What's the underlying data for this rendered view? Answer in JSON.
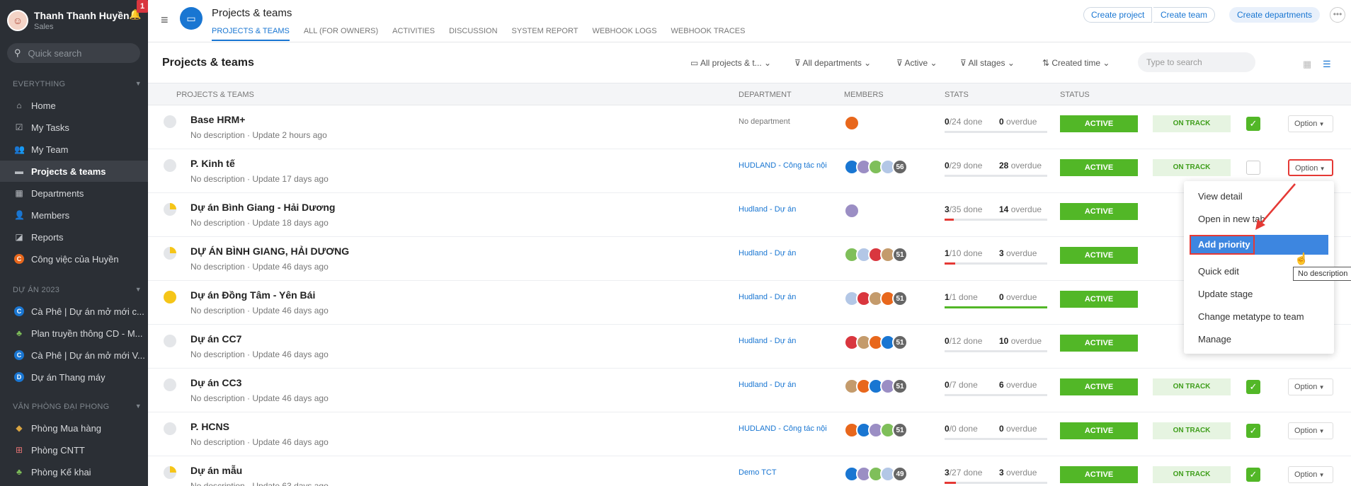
{
  "user": {
    "name": "Thanh Thanh Huyền",
    "role": "Sales",
    "notif_count": "1"
  },
  "sidebar": {
    "search_placeholder": "Quick search",
    "section1": "EVERYTHING",
    "items": [
      {
        "label": "Home",
        "icon": "home-icon"
      },
      {
        "label": "My Tasks",
        "icon": "check-icon"
      },
      {
        "label": "My Team",
        "icon": "users-icon"
      },
      {
        "label": "Projects & teams",
        "icon": "folder-icon"
      },
      {
        "label": "Departments",
        "icon": "building-icon"
      },
      {
        "label": "Members",
        "icon": "user-icon"
      },
      {
        "label": "Reports",
        "icon": "chart-icon"
      },
      {
        "label": "Công việc của Huyền",
        "icon": "C"
      }
    ],
    "section2": "DỰ ÁN 2023",
    "projects": [
      {
        "label": "Cà Phê | Dự án mở mới c...",
        "icon": "C"
      },
      {
        "label": "Plan truyền thông CD - M...",
        "icon": "tree-icon"
      },
      {
        "label": "Cà Phê | Dự án mở mới V...",
        "icon": "C"
      },
      {
        "label": "Dự án Thang máy",
        "icon": "D"
      }
    ],
    "section3": "VĂN PHÒNG ĐẠI PHONG",
    "offices": [
      {
        "label": "Phòng Mua hàng",
        "icon": "tag-icon"
      },
      {
        "label": "Phòng CNTT",
        "icon": "hierarchy-icon"
      },
      {
        "label": "Phòng Kế khai",
        "icon": "tree-icon"
      }
    ]
  },
  "header": {
    "title": "Projects & teams",
    "tabs": [
      "PROJECTS & TEAMS",
      "ALL (FOR OWNERS)",
      "ACTIVITIES",
      "DISCUSSION",
      "SYSTEM REPORT",
      "WEBHOOK LOGS",
      "WEBHOOK TRACES"
    ],
    "btn_create_project": "Create project",
    "btn_create_team": "Create team",
    "btn_create_departments": "Create departments"
  },
  "toolbar": {
    "title": "Projects & teams",
    "filters": [
      "All projects & t...",
      "All departments",
      "Active",
      "All stages",
      "Created time"
    ],
    "search_placeholder": "Type to search"
  },
  "table": {
    "headers": [
      "PROJECTS & TEAMS",
      "DEPARTMENT",
      "MEMBERS",
      "STATS",
      "STATUS"
    ],
    "done_label": "done",
    "overdue_label": "overdue",
    "rows": [
      {
        "name": "Base HRM+",
        "desc": "No description · Update 2 hours ago",
        "dept": "No department",
        "members": "",
        "done": "0",
        "total": "/24",
        "overdue": "0",
        "status": "ACTIVE",
        "track": "ON TRACK",
        "option": "Option",
        "progress": 0,
        "checked": true
      },
      {
        "name": "P. Kinh tế",
        "desc": "No description · Update 17 days ago",
        "dept": "HUDLAND - Công tác nội",
        "members": "56",
        "done": "0",
        "total": "/29",
        "overdue": "28",
        "status": "ACTIVE",
        "track": "ON TRACK",
        "option": "Option",
        "progress": 0,
        "checked": false
      },
      {
        "name": "Dự án Bình Giang - Hải Dương",
        "desc": "No description · Update 18 days ago",
        "dept": "Hudland - Dự án",
        "members": "",
        "done": "3",
        "total": "/35",
        "overdue": "14",
        "status": "ACTIVE",
        "track": "",
        "option": "",
        "progress": 0.086,
        "checked": false
      },
      {
        "name": "DỰ ÁN BÌNH GIANG, HẢI DƯƠNG",
        "desc": "No description · Update 46 days ago",
        "dept": "Hudland - Dự án",
        "members": "51",
        "done": "1",
        "total": "/10",
        "overdue": "3",
        "status": "ACTIVE",
        "track": "",
        "option": "",
        "progress": 0.1,
        "checked": false
      },
      {
        "name": "Dự án Đồng Tâm - Yên Bái",
        "desc": "No description · Update 46 days ago",
        "dept": "Hudland - Dự án",
        "members": "51",
        "done": "1",
        "total": "/1",
        "overdue": "0",
        "status": "ACTIVE",
        "track": "",
        "option": "",
        "progress": 1,
        "checked": false
      },
      {
        "name": "Dự án CC7",
        "desc": "No description · Update 46 days ago",
        "dept": "Hudland - Dự án",
        "members": "51",
        "done": "0",
        "total": "/12",
        "overdue": "10",
        "status": "ACTIVE",
        "track": "",
        "option": "",
        "progress": 0,
        "checked": false
      },
      {
        "name": "Dự án CC3",
        "desc": "No description · Update 46 days ago",
        "dept": "Hudland - Dự án",
        "members": "51",
        "done": "0",
        "total": "/7",
        "overdue": "6",
        "status": "ACTIVE",
        "track": "ON TRACK",
        "option": "Option",
        "progress": 0,
        "checked": true
      },
      {
        "name": "P. HCNS",
        "desc": "No description · Update 46 days ago",
        "dept": "HUDLAND - Công tác nội",
        "members": "51",
        "done": "0",
        "total": "/0",
        "overdue": "0",
        "status": "ACTIVE",
        "track": "ON TRACK",
        "option": "Option",
        "progress": 0,
        "checked": true
      },
      {
        "name": "Dự án mẫu",
        "desc": "No description · Update 63 days ago",
        "dept": "Demo TCT",
        "members": "49",
        "done": "3",
        "total": "/27",
        "overdue": "3",
        "status": "ACTIVE",
        "track": "ON TRACK",
        "option": "Option",
        "progress": 0.11,
        "checked": true
      }
    ]
  },
  "menu": {
    "items": [
      "View detail",
      "Open in new tab",
      "Add priority",
      "Quick edit",
      "Update stage",
      "Change metatype to team",
      "Manage"
    ],
    "tooltip": "No description"
  },
  "colors": {
    "accent": "#1976d2",
    "active": "#52b727",
    "highlight": "#e53935"
  }
}
